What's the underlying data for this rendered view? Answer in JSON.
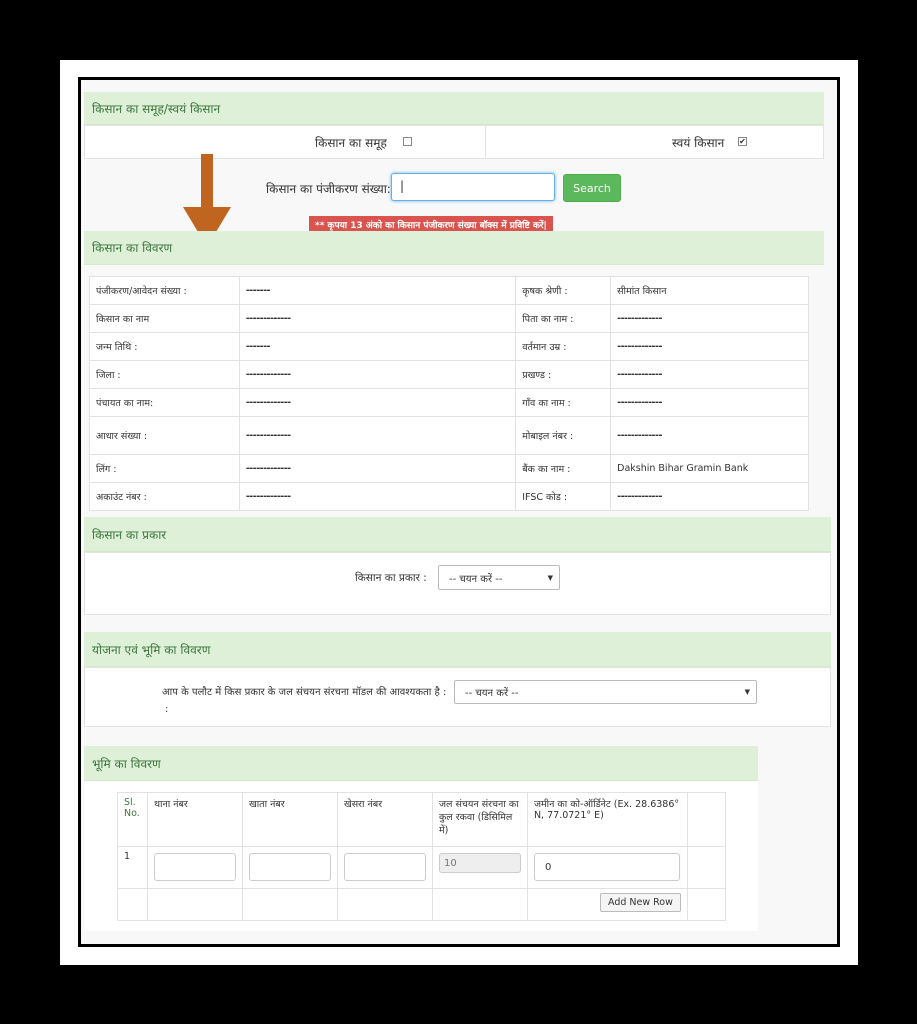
{
  "group_section": {
    "title": "किसान का समूह/स्वयं किसान",
    "group_label": "किसान का समूह",
    "group_checked": false,
    "self_label": "स्वयं किसान",
    "self_checked": true
  },
  "registration": {
    "label": "किसान का पंजीकरण संख्या:",
    "value": "|",
    "search_label": "Search",
    "notice": "** कृपया 13 अंको का किसान पंजीकरण संख्या बॉक्स में प्रविष्टि करें|"
  },
  "farmer_details": {
    "title": "किसान का विवरण",
    "rows": [
      {
        "l1": "पंजीकरण/आवेदन संख्या :",
        "v1": "-------",
        "l2": "कृषक श्रेणी :",
        "v2": "सीमांत किसान"
      },
      {
        "l1": "किसान का नाम",
        "v1": "-------------",
        "l2": "पिता का नाम :",
        "v2": "-------------"
      },
      {
        "l1": "जन्म तिथि :",
        "v1": "-------",
        "l2": "वर्तमान उम्र :",
        "v2": "-------------"
      },
      {
        "l1": "जिला :",
        "v1": "-------------",
        "l2": "प्रखण्ड :",
        "v2": "-------------"
      },
      {
        "l1": "पंचायत का नाम:",
        "v1": "-------------",
        "l2": "गाँव का नाम :",
        "v2": "-------------"
      },
      {
        "l1": "आधार संख्या :",
        "v1": "-------------",
        "l2": "मोबाइल नंबर :",
        "v2": "-------------"
      },
      {
        "l1": "लिंग :",
        "v1": "-------------",
        "l2": "बैंक का नाम :",
        "v2": "Dakshin Bihar Gramin Bank"
      },
      {
        "l1": "अकाउंट नंबर :",
        "v1": "-------------",
        "l2": "IFSC कोड :",
        "v2": "-------------"
      }
    ]
  },
  "farmer_type": {
    "title": "किसान का प्रकार",
    "label": "किसान का प्रकार :",
    "selected": "-- चयन करें --"
  },
  "scheme": {
    "title": "योजना एवं भूमि का विवरण",
    "label": "आप के पलौट में किस प्रकार के जल संचयन संरचना मॉडल की आवश्यकता है :",
    "selected": "-- चयन करें --"
  },
  "land": {
    "title": "भूमि का विवरण",
    "headers": [
      "Sl. No.",
      "थाना नंबर",
      "खाता नंबर",
      "खेसरा नंबर",
      "जल संचयन संरचना का कुल रकवा (डिसिमिल में)",
      "जमीन का को-ऑर्डिनेट (Ex. 28.6386° N, 77.0721° E)"
    ],
    "row": {
      "sl": "1",
      "area": "10",
      "coord": "0"
    },
    "add_row_label": "Add New Row"
  },
  "colors": {
    "panel_green": "#dff0d8",
    "panel_text": "#3c763d",
    "search_green": "#5cb85c",
    "notice_red": "#d9534f",
    "arrow": "#c0651f"
  }
}
